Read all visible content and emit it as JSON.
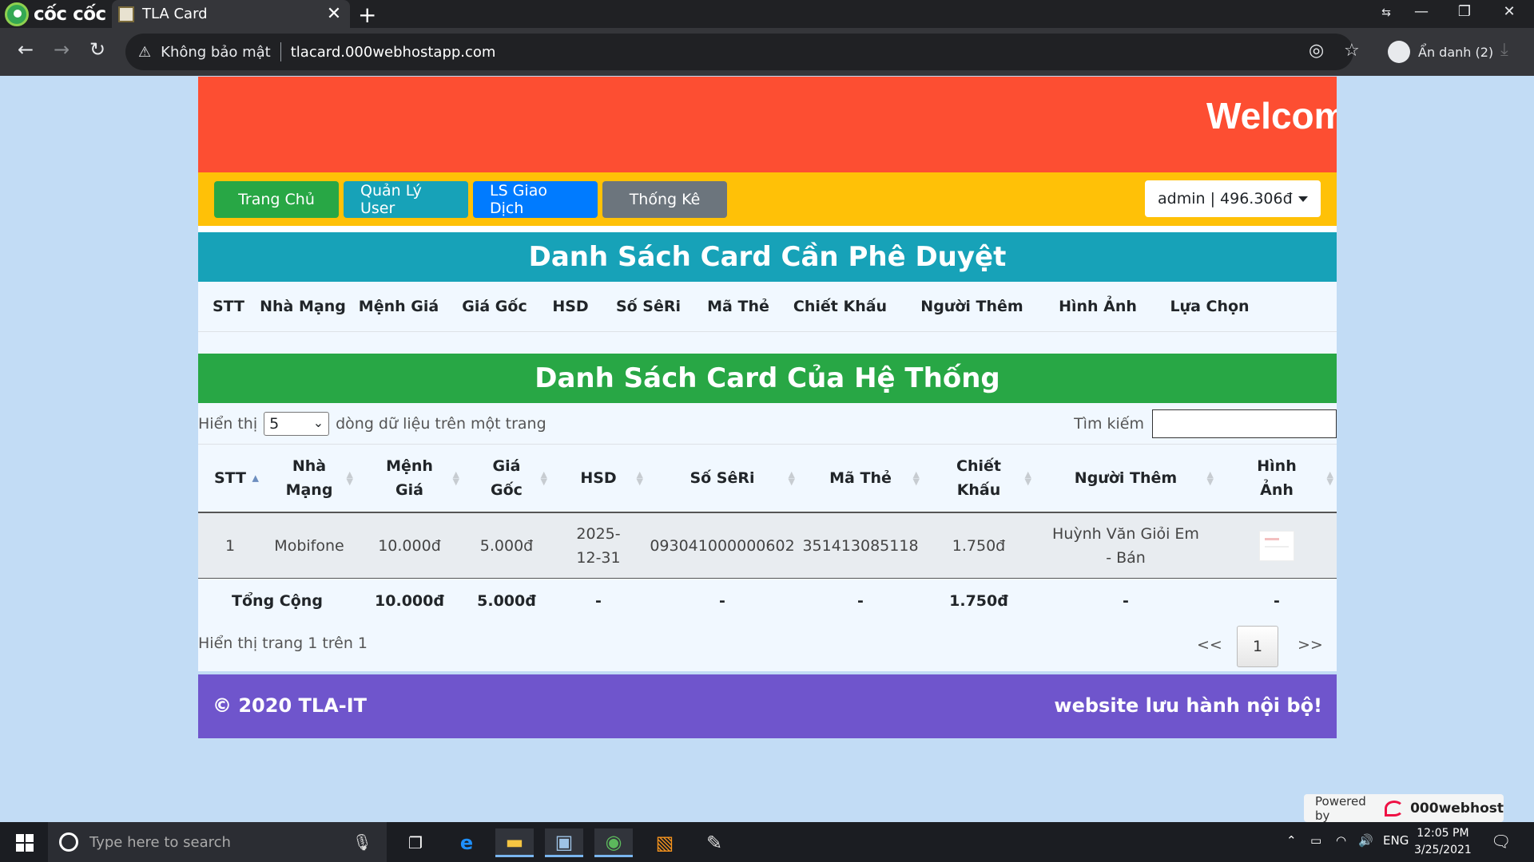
{
  "browser": {
    "brand": "cốc cốc",
    "tab_title": "TLA Card",
    "security_label": "Không bảo mật",
    "url": "tlacard.000webhostapp.com",
    "incognito_label": "Ẩn danh (2)"
  },
  "banner": {
    "text": "Welcom"
  },
  "nav": {
    "home": "Trang Chủ",
    "users": "Quản Lý User",
    "transactions": "LS Giao Dịch",
    "stats": "Thống Kê",
    "account": "admin | 496.306đ"
  },
  "pending": {
    "title": "Danh Sách Card Cần Phê Duyệt",
    "columns": [
      "STT",
      "Nhà Mạng",
      "Mệnh Giá",
      "Giá Gốc",
      "HSD",
      "Số SêRi",
      "Mã Thẻ",
      "Chiết Khấu",
      "Người Thêm",
      "Hình Ảnh",
      "Lựa Chọn"
    ]
  },
  "system": {
    "title": "Danh Sách Card Của Hệ Thống",
    "show_prefix": "Hiển thị",
    "page_size": "5",
    "show_suffix": "dòng dữ liệu trên một trang",
    "search_label": "Tìm kiếm",
    "columns": [
      "STT",
      "Nhà Mạng",
      "Mệnh Giá",
      "Giá Gốc",
      "HSD",
      "Số SêRi",
      "Mã Thẻ",
      "Chiết Khấu",
      "Người Thêm",
      "Hình Ảnh"
    ],
    "rows": [
      {
        "stt": "1",
        "network": "Mobifone",
        "face_value": "10.000đ",
        "cost": "5.000đ",
        "expiry": "2025-12-31",
        "serial": "093041000000602",
        "code": "351413085118",
        "discount": "1.750đ",
        "added_by": "Huỳnh Văn Giỏi Em - Bán"
      }
    ],
    "totals": {
      "label": "Tổng Cộng",
      "face_value": "10.000đ",
      "cost": "5.000đ",
      "expiry": "-",
      "serial": "-",
      "code": "-",
      "discount": "1.750đ",
      "added_by": "-",
      "image": "-"
    },
    "page_info": "Hiển thị trang 1 trên 1",
    "prev": "<<",
    "current_page": "1",
    "next": ">>"
  },
  "footer": {
    "copyright": "© 2020 TLA-IT",
    "note": "website lưu hành nội bộ!"
  },
  "powered": {
    "prefix": "Powered by",
    "brand": "000webhost"
  },
  "taskbar": {
    "search_placeholder": "Type here to search",
    "lang": "ENG",
    "time": "12:05 PM",
    "date": "3/25/2021"
  }
}
